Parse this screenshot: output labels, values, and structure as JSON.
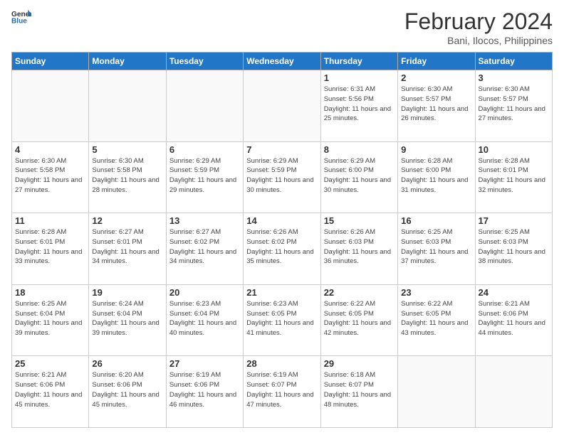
{
  "header": {
    "logo_general": "General",
    "logo_blue": "Blue",
    "month_year": "February 2024",
    "location": "Bani, Ilocos, Philippines"
  },
  "days_of_week": [
    "Sunday",
    "Monday",
    "Tuesday",
    "Wednesday",
    "Thursday",
    "Friday",
    "Saturday"
  ],
  "weeks": [
    [
      {
        "day": "",
        "sunrise": "",
        "sunset": "",
        "daylight": ""
      },
      {
        "day": "",
        "sunrise": "",
        "sunset": "",
        "daylight": ""
      },
      {
        "day": "",
        "sunrise": "",
        "sunset": "",
        "daylight": ""
      },
      {
        "day": "",
        "sunrise": "",
        "sunset": "",
        "daylight": ""
      },
      {
        "day": "1",
        "sunrise": "6:31 AM",
        "sunset": "5:56 PM",
        "daylight": "11 hours and 25 minutes."
      },
      {
        "day": "2",
        "sunrise": "6:30 AM",
        "sunset": "5:57 PM",
        "daylight": "11 hours and 26 minutes."
      },
      {
        "day": "3",
        "sunrise": "6:30 AM",
        "sunset": "5:57 PM",
        "daylight": "11 hours and 27 minutes."
      }
    ],
    [
      {
        "day": "4",
        "sunrise": "6:30 AM",
        "sunset": "5:58 PM",
        "daylight": "11 hours and 27 minutes."
      },
      {
        "day": "5",
        "sunrise": "6:30 AM",
        "sunset": "5:58 PM",
        "daylight": "11 hours and 28 minutes."
      },
      {
        "day": "6",
        "sunrise": "6:29 AM",
        "sunset": "5:59 PM",
        "daylight": "11 hours and 29 minutes."
      },
      {
        "day": "7",
        "sunrise": "6:29 AM",
        "sunset": "5:59 PM",
        "daylight": "11 hours and 30 minutes."
      },
      {
        "day": "8",
        "sunrise": "6:29 AM",
        "sunset": "6:00 PM",
        "daylight": "11 hours and 30 minutes."
      },
      {
        "day": "9",
        "sunrise": "6:28 AM",
        "sunset": "6:00 PM",
        "daylight": "11 hours and 31 minutes."
      },
      {
        "day": "10",
        "sunrise": "6:28 AM",
        "sunset": "6:01 PM",
        "daylight": "11 hours and 32 minutes."
      }
    ],
    [
      {
        "day": "11",
        "sunrise": "6:28 AM",
        "sunset": "6:01 PM",
        "daylight": "11 hours and 33 minutes."
      },
      {
        "day": "12",
        "sunrise": "6:27 AM",
        "sunset": "6:01 PM",
        "daylight": "11 hours and 34 minutes."
      },
      {
        "day": "13",
        "sunrise": "6:27 AM",
        "sunset": "6:02 PM",
        "daylight": "11 hours and 34 minutes."
      },
      {
        "day": "14",
        "sunrise": "6:26 AM",
        "sunset": "6:02 PM",
        "daylight": "11 hours and 35 minutes."
      },
      {
        "day": "15",
        "sunrise": "6:26 AM",
        "sunset": "6:03 PM",
        "daylight": "11 hours and 36 minutes."
      },
      {
        "day": "16",
        "sunrise": "6:25 AM",
        "sunset": "6:03 PM",
        "daylight": "11 hours and 37 minutes."
      },
      {
        "day": "17",
        "sunrise": "6:25 AM",
        "sunset": "6:03 PM",
        "daylight": "11 hours and 38 minutes."
      }
    ],
    [
      {
        "day": "18",
        "sunrise": "6:25 AM",
        "sunset": "6:04 PM",
        "daylight": "11 hours and 39 minutes."
      },
      {
        "day": "19",
        "sunrise": "6:24 AM",
        "sunset": "6:04 PM",
        "daylight": "11 hours and 39 minutes."
      },
      {
        "day": "20",
        "sunrise": "6:23 AM",
        "sunset": "6:04 PM",
        "daylight": "11 hours and 40 minutes."
      },
      {
        "day": "21",
        "sunrise": "6:23 AM",
        "sunset": "6:05 PM",
        "daylight": "11 hours and 41 minutes."
      },
      {
        "day": "22",
        "sunrise": "6:22 AM",
        "sunset": "6:05 PM",
        "daylight": "11 hours and 42 minutes."
      },
      {
        "day": "23",
        "sunrise": "6:22 AM",
        "sunset": "6:05 PM",
        "daylight": "11 hours and 43 minutes."
      },
      {
        "day": "24",
        "sunrise": "6:21 AM",
        "sunset": "6:06 PM",
        "daylight": "11 hours and 44 minutes."
      }
    ],
    [
      {
        "day": "25",
        "sunrise": "6:21 AM",
        "sunset": "6:06 PM",
        "daylight": "11 hours and 45 minutes."
      },
      {
        "day": "26",
        "sunrise": "6:20 AM",
        "sunset": "6:06 PM",
        "daylight": "11 hours and 45 minutes."
      },
      {
        "day": "27",
        "sunrise": "6:19 AM",
        "sunset": "6:06 PM",
        "daylight": "11 hours and 46 minutes."
      },
      {
        "day": "28",
        "sunrise": "6:19 AM",
        "sunset": "6:07 PM",
        "daylight": "11 hours and 47 minutes."
      },
      {
        "day": "29",
        "sunrise": "6:18 AM",
        "sunset": "6:07 PM",
        "daylight": "11 hours and 48 minutes."
      },
      {
        "day": "",
        "sunrise": "",
        "sunset": "",
        "daylight": ""
      },
      {
        "day": "",
        "sunrise": "",
        "sunset": "",
        "daylight": ""
      }
    ]
  ]
}
